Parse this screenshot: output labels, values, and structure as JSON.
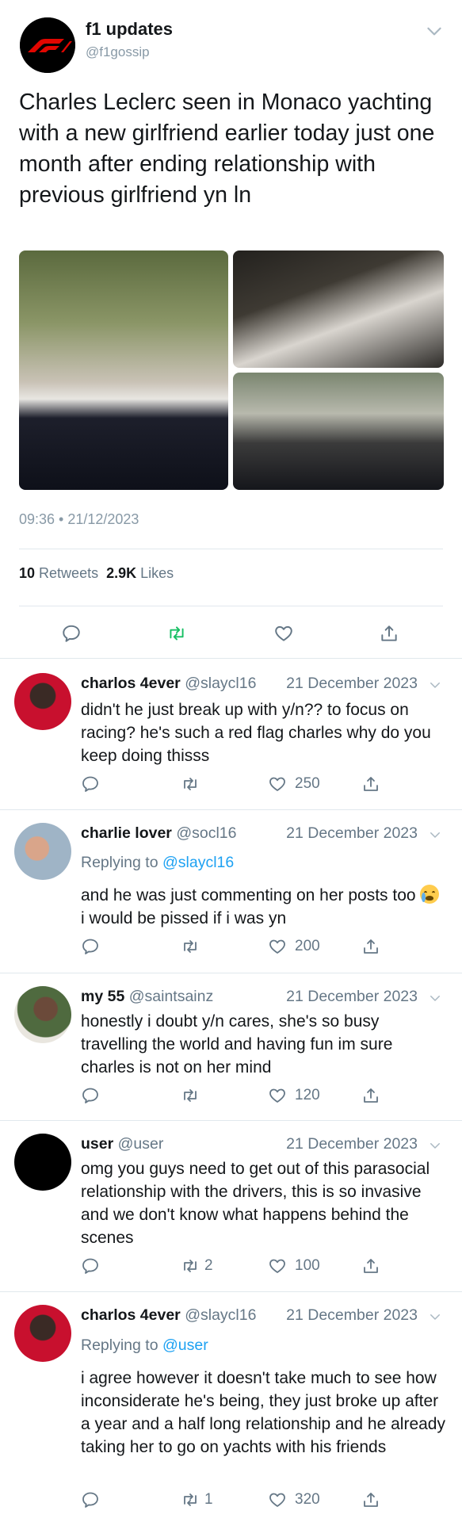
{
  "tweet": {
    "author_name": "f1 updates",
    "author_handle": "@f1gossip",
    "text": "Charles Leclerc seen in Monaco yachting with a new girlfriend earlier today just one month after ending relationship with previous girlfriend yn ln",
    "timestamp": "09:36 • 21/12/2023",
    "retweets_count": "10",
    "retweets_label": "Retweets",
    "likes_count": "2.9K",
    "likes_label": "Likes"
  },
  "icons": {
    "reply": "reply-icon",
    "retweet": "retweet-icon",
    "like": "heart-icon",
    "share": "share-icon",
    "more": "chevron-down-icon"
  },
  "colors": {
    "accent": "#1da1f2",
    "retweet_green": "#17bf63",
    "muted": "#657786",
    "divider": "#e1e8ed"
  },
  "replies": [
    {
      "name": "charlos 4ever",
      "handle": "@slaycl16",
      "date": "21 December 2023",
      "replying_label": "",
      "replying_to": "",
      "text": "didn't he just break up with y/n?? to focus on racing? he's such a red flag charles why do you keep doing thisss",
      "retweets": "",
      "likes": "250"
    },
    {
      "name": "charlie lover",
      "handle": "@socl16",
      "date": "21 December 2023",
      "replying_label": "Replying to",
      "replying_to": "@slaycl16",
      "text_before_emoji": "and he was just commenting on her posts too",
      "text_after_emoji": "i would be pissed if i was yn",
      "retweets": "",
      "likes": "200"
    },
    {
      "name": "my 55",
      "handle": "@saintsainz",
      "date": "21 December 2023",
      "replying_label": "",
      "replying_to": "",
      "text": "honestly i doubt y/n cares, she's so busy travelling the world and having fun im sure charles is not on her mind",
      "retweets": "",
      "likes": "120"
    },
    {
      "name": "user",
      "handle": "@user",
      "date": "21 December 2023",
      "replying_label": "",
      "replying_to": "",
      "text": "omg you guys need to get out of this parasocial relationship with the drivers, this is so invasive and we don't know what happens behind the scenes",
      "retweets": "2",
      "likes": "100"
    },
    {
      "name": "charlos 4ever",
      "handle": "@slaycl16",
      "date": "21 December 2023",
      "replying_label": "Replying to",
      "replying_to": "@user",
      "text": "i agree however it doesn't take much to see how inconsiderate he's being, they just broke up after a year and a half long relationship and he already taking her to go on yachts with his friends",
      "retweets": "1",
      "likes": "320"
    }
  ]
}
